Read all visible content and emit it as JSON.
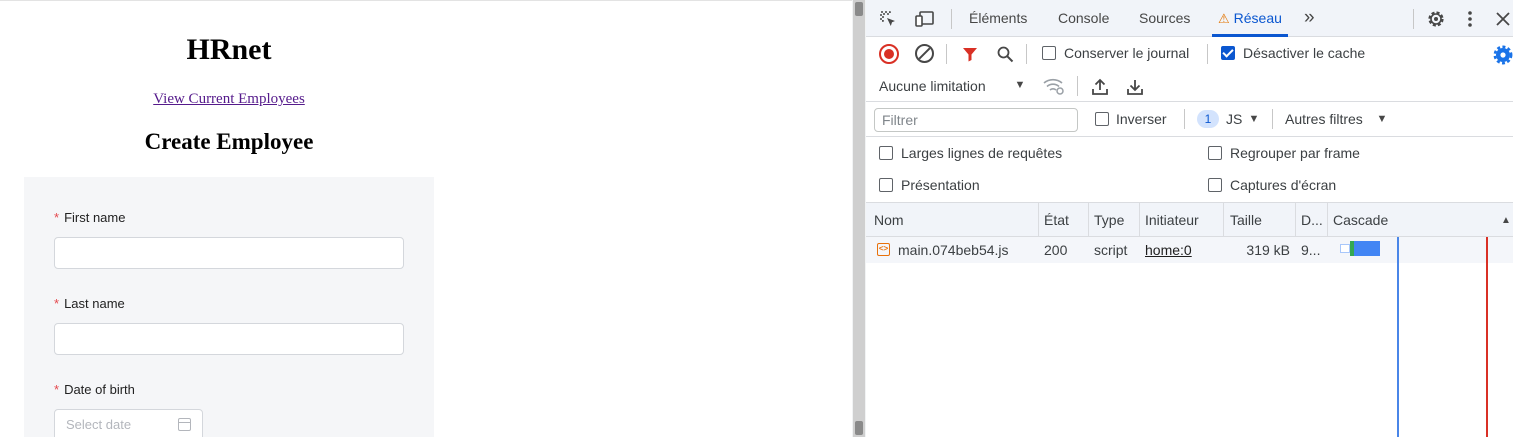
{
  "page": {
    "title": "HRnet",
    "view_link": "View Current Employees",
    "form_title": "Create Employee",
    "fields": {
      "first_name": {
        "label": "First name",
        "required_mark": "*"
      },
      "last_name": {
        "label": "Last name",
        "required_mark": "*"
      },
      "dob": {
        "label": "Date of birth",
        "required_mark": "*",
        "placeholder": "Select date"
      }
    }
  },
  "devtools": {
    "tabs": [
      {
        "label": "Éléments"
      },
      {
        "label": "Console"
      },
      {
        "label": "Sources"
      },
      {
        "label": "Réseau",
        "active": true,
        "warning_glyph": "⚠"
      }
    ],
    "more_tabs_glyph": "»",
    "toolbar": {
      "preserve_log": {
        "label": "Conserver le journal",
        "checked": false
      },
      "disable_cache": {
        "label": "Désactiver le cache",
        "checked": true
      },
      "throttling": "Aucune limitation"
    },
    "filter": {
      "placeholder": "Filtrer",
      "invert": {
        "label": "Inverser",
        "checked": false
      },
      "badge_count": "1",
      "type_filter": "JS",
      "more_filters": "Autres filtres"
    },
    "options": {
      "big_rows": {
        "label": "Larges lignes de requêtes",
        "checked": false
      },
      "group_by_frame": {
        "label": "Regrouper par frame",
        "checked": false
      },
      "overview": {
        "label": "Présentation",
        "checked": false
      },
      "screenshots": {
        "label": "Captures d'écran",
        "checked": false
      }
    },
    "columns": [
      "Nom",
      "État",
      "Type",
      "Initiateur",
      "Taille",
      "D...",
      "Cascade"
    ],
    "rows": [
      {
        "name": "main.074beb54.js",
        "status": "200",
        "type": "script",
        "initiator": "home:0",
        "size": "319 kB",
        "time": "9..."
      }
    ],
    "colors": {
      "accent": "#0b57d0",
      "record": "#d93025",
      "warning": "#e37400"
    }
  }
}
